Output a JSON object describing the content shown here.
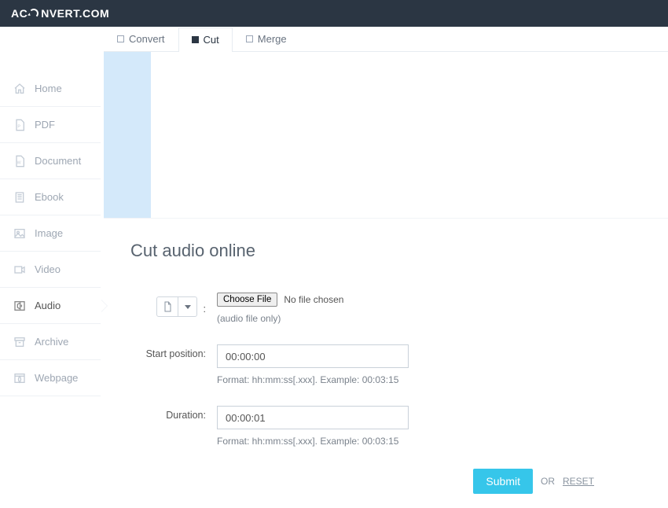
{
  "header": {
    "brand_pre": "AC",
    "brand_post": "NVERT.COM"
  },
  "sidebar": {
    "items": [
      {
        "label": "Home"
      },
      {
        "label": "PDF"
      },
      {
        "label": "Document"
      },
      {
        "label": "Ebook"
      },
      {
        "label": "Image"
      },
      {
        "label": "Video"
      },
      {
        "label": "Audio"
      },
      {
        "label": "Archive"
      },
      {
        "label": "Webpage"
      }
    ]
  },
  "tabs": {
    "convert": "Convert",
    "cut": "Cut",
    "merge": "Merge"
  },
  "page": {
    "title": "Cut audio online",
    "choose_file": "Choose File",
    "no_file": "No file chosen",
    "file_hint": "(audio file only)",
    "start_label": "Start position:",
    "start_value": "00:00:00",
    "start_fmt": "Format: hh:mm:ss[.xxx]. Example: 00:03:15",
    "duration_label": "Duration:",
    "duration_value": "00:00:01",
    "duration_fmt": "Format: hh:mm:ss[.xxx]. Example: 00:03:15",
    "submit": "Submit",
    "or": "OR",
    "reset": "RESET"
  }
}
